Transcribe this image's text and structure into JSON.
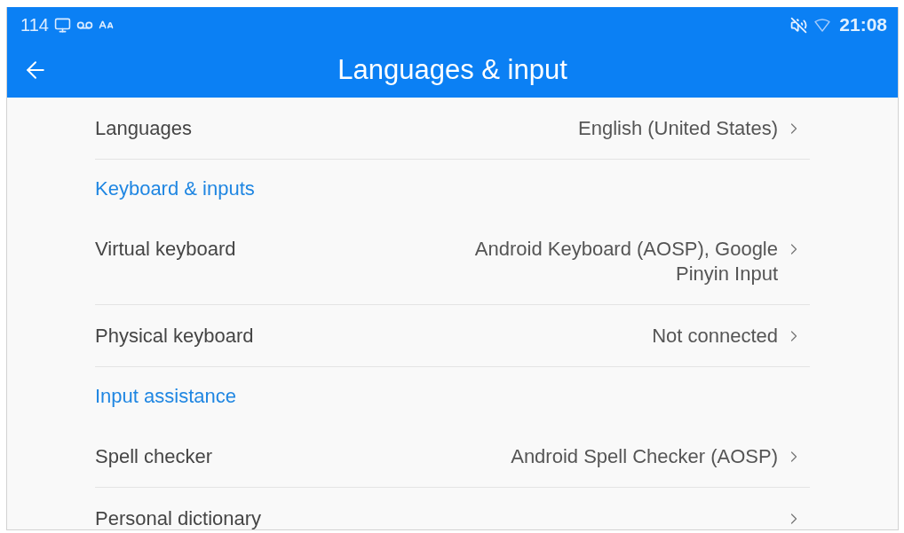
{
  "status_bar": {
    "status_text": "114",
    "time": "21:08"
  },
  "app_bar": {
    "title": "Languages & input"
  },
  "sections": [
    {
      "items": [
        {
          "label": "Languages",
          "value": "English (United States)"
        }
      ]
    },
    {
      "header": "Keyboard & inputs",
      "items": [
        {
          "label": "Virtual keyboard",
          "value": "Android Keyboard (AOSP), Google Pinyin Input"
        },
        {
          "label": "Physical keyboard",
          "value": "Not connected"
        }
      ]
    },
    {
      "header": "Input assistance",
      "items": [
        {
          "label": "Spell checker",
          "value": "Android Spell Checker (AOSP)"
        },
        {
          "label": "Personal dictionary"
        }
      ]
    }
  ]
}
